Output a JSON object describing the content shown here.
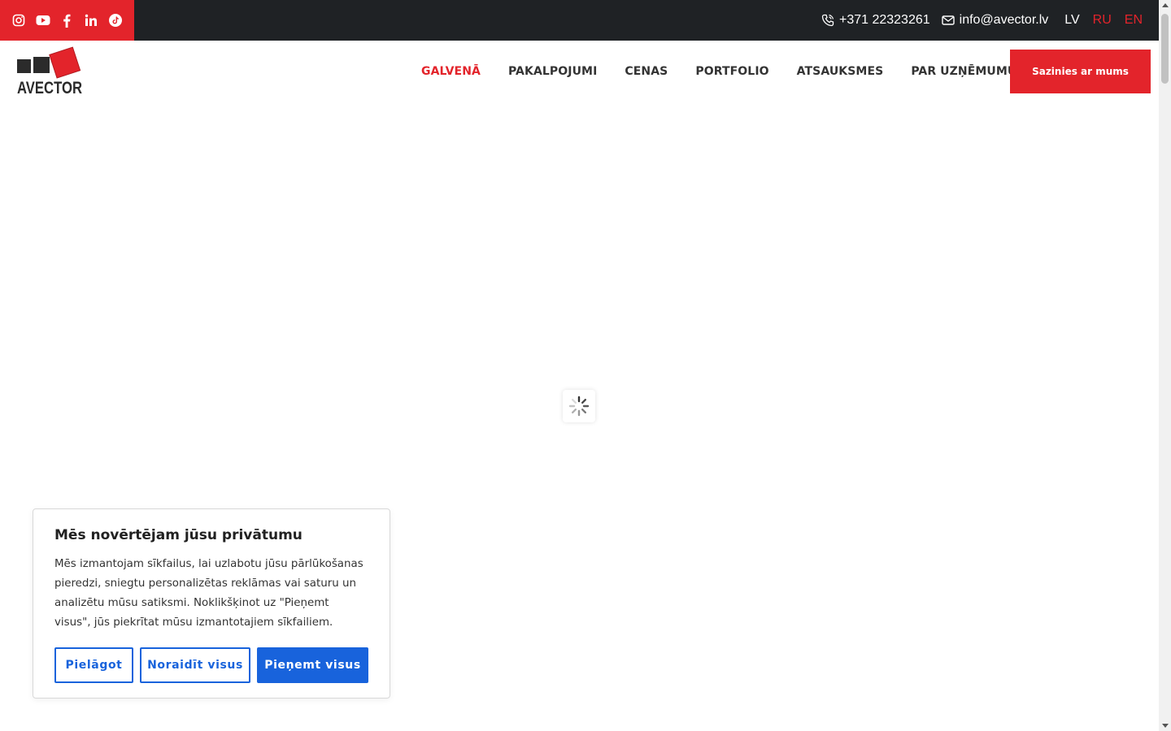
{
  "topbar": {
    "socials": [
      {
        "icon": "instagram-icon"
      },
      {
        "icon": "youtube-icon"
      },
      {
        "icon": "facebook-icon"
      },
      {
        "icon": "linkedin-icon"
      },
      {
        "icon": "tiktok-icon"
      }
    ],
    "phone": "+371 22323261",
    "email": "info@avector.lv",
    "languages": [
      "LV",
      "RU",
      "EN"
    ],
    "active_language": "LV"
  },
  "header": {
    "logo_text": "AVECTOR",
    "nav": [
      {
        "label": "GALVENĀ",
        "active": true
      },
      {
        "label": "PAKALPOJUMI"
      },
      {
        "label": "CENAS"
      },
      {
        "label": "PORTFOLIO"
      },
      {
        "label": "ATSAUKSMES"
      },
      {
        "label": "PAR UZŅĒMUMU"
      }
    ],
    "cta_label": "Sazinies ar mums"
  },
  "cookie": {
    "title": "Mēs novērtējam jūsu privātumu",
    "text": "Mēs izmantojam sīkfailus, lai uzlabotu jūsu pārlūkošanas pieredzi, sniegtu personalizētas reklāmas vai saturu un analizētu mūsu satiksmi. Noklikšķinot uz \"Pieņemt visus\", jūs piekrītat mūsu izmantotajiem sīkfailiem.",
    "customize_label": "Pielāgot",
    "reject_label": "Noraidīt visus",
    "accept_label": "Pieņemt visus"
  },
  "colors": {
    "brand_red": "#e3242b",
    "topbar_dark": "#1f2225",
    "cookie_blue": "#1863dc"
  }
}
